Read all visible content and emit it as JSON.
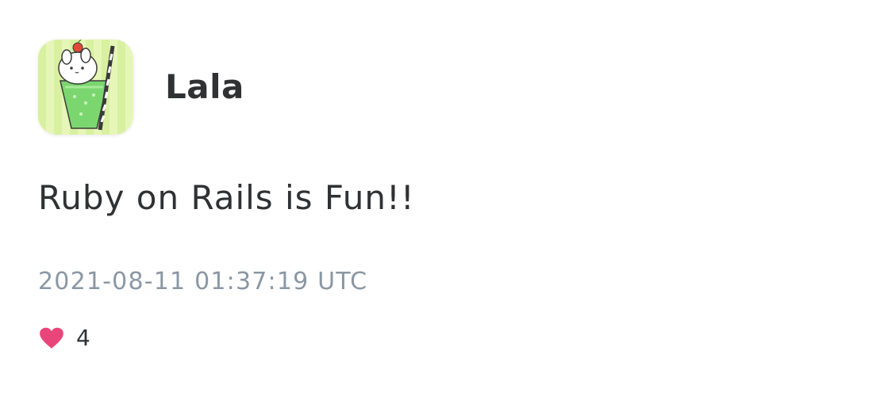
{
  "post": {
    "author": {
      "name": "Lala",
      "avatar_description": "cartoon rabbit in a green melon-soda glass with a striped straw"
    },
    "content": "Ruby on Rails is Fun!!",
    "created_at": "2021-08-11 01:37:19 UTC",
    "likes": {
      "icon": "heart-icon",
      "count": "4",
      "color": "#e8467a"
    }
  }
}
